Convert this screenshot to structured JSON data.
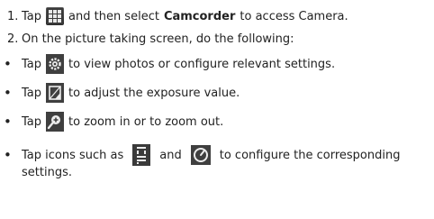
{
  "steps": [
    {
      "num": "1.",
      "a": "Tap",
      "b": "and then select",
      "c": "Camcorder",
      "d": "to access Camera."
    },
    {
      "num": "2.",
      "text": "On the picture taking screen, do the following:"
    }
  ],
  "bullets": [
    {
      "a": "Tap",
      "icon": "gear-icon",
      "b": "to view photos or configure relevant settings."
    },
    {
      "a": "Tap",
      "icon": "exposure-icon",
      "b": "to adjust the exposure value."
    },
    {
      "a": "Tap",
      "icon": "zoom-icon",
      "b": "to zoom in or to zoom out."
    },
    {
      "a": "Tap icons such as",
      "icon1": "hdr-icon",
      "mid": "and",
      "icon2": "timer-icon",
      "b": "to configure the corresponding",
      "cont": "settings."
    }
  ],
  "bullet_char": "•",
  "colors": {
    "icon_dark": "#3a3a3a",
    "text": "#222222"
  }
}
